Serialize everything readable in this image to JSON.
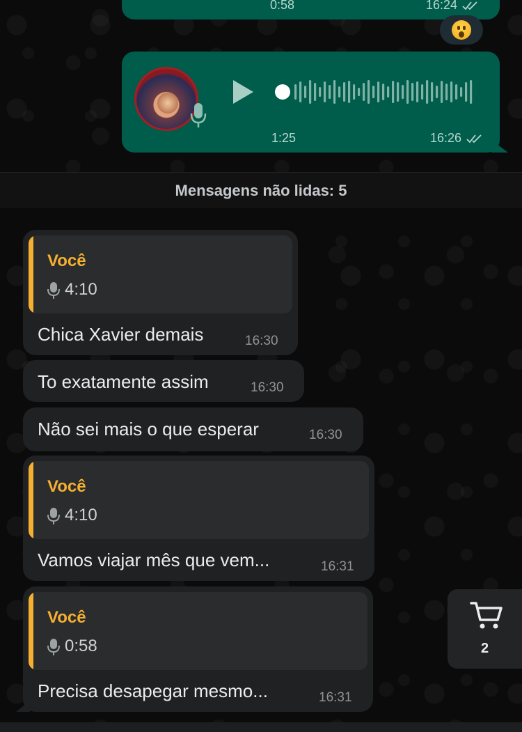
{
  "top_message": {
    "duration": "0:58",
    "time": "16:24"
  },
  "voice_message": {
    "duration": "1:25",
    "time": "16:26"
  },
  "unread_divider": {
    "label": "Mensagens não lidas: 5"
  },
  "messages": [
    {
      "quote": {
        "author": "Você",
        "duration": "4:10"
      },
      "text": "Chica Xavier demais",
      "time": "16:30"
    },
    {
      "text": "To exatamente assim",
      "time": "16:30"
    },
    {
      "text": "Não sei mais o que esperar",
      "time": "16:30"
    },
    {
      "quote": {
        "author": "Você",
        "duration": "4:10"
      },
      "text": "Vamos viajar mês que vem...",
      "time": "16:31"
    },
    {
      "quote": {
        "author": "Você",
        "duration": "0:58"
      },
      "text": "Precisa desapegar mesmo...",
      "time": "16:31"
    }
  ],
  "cart": {
    "icon": "cart-icon",
    "count": "2"
  },
  "colors": {
    "outgoing": "#005c4b",
    "incoming": "#1f2123",
    "quote_accent": "#f5b031",
    "background": "#0b0b0b"
  },
  "icons": {
    "reaction": "astonished-face-emoji",
    "play": "play-icon",
    "mic": "microphone-icon",
    "read_receipt": "double-check-icon"
  }
}
